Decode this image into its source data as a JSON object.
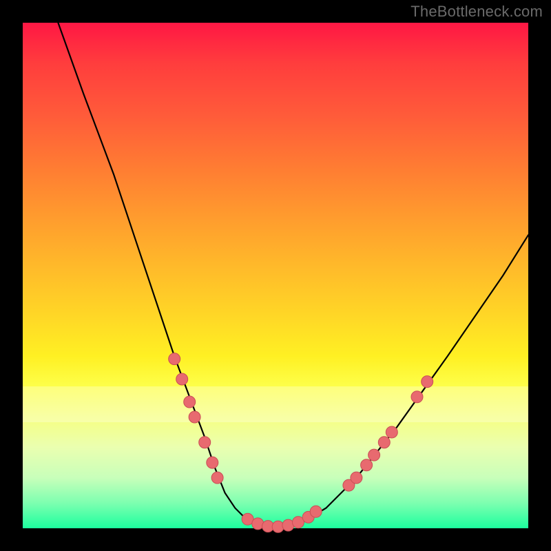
{
  "watermark": "TheBottleneck.com",
  "colors": {
    "frame": "#000000",
    "dot_fill": "#e86a6f",
    "dot_stroke": "#c94e55",
    "curve": "#000000"
  },
  "chart_data": {
    "type": "line",
    "title": "",
    "xlabel": "",
    "ylabel": "",
    "xlim": [
      0,
      100
    ],
    "ylim": [
      0,
      100
    ],
    "grid": false,
    "legend": "none",
    "series": [
      {
        "name": "bottleneck-curve",
        "x": [
          7,
          12,
          18,
          23,
          27,
          30,
          33,
          36,
          38,
          40,
          42,
          44,
          47,
          51,
          55,
          60,
          66,
          74,
          84,
          95,
          100
        ],
        "y": [
          100,
          86,
          70,
          55,
          43,
          34,
          26,
          18,
          12,
          7,
          4,
          2,
          0,
          0,
          1,
          4,
          10,
          20,
          34,
          50,
          58
        ]
      }
    ],
    "scatter": {
      "name": "highlight-dots",
      "points": [
        {
          "x": 30.0,
          "y": 33.5
        },
        {
          "x": 31.5,
          "y": 29.5
        },
        {
          "x": 33.0,
          "y": 25.0
        },
        {
          "x": 34.0,
          "y": 22.0
        },
        {
          "x": 36.0,
          "y": 17.0
        },
        {
          "x": 37.5,
          "y": 13.0
        },
        {
          "x": 38.5,
          "y": 10.0
        },
        {
          "x": 44.5,
          "y": 1.8
        },
        {
          "x": 46.5,
          "y": 0.9
        },
        {
          "x": 48.5,
          "y": 0.4
        },
        {
          "x": 50.5,
          "y": 0.3
        },
        {
          "x": 52.5,
          "y": 0.6
        },
        {
          "x": 54.5,
          "y": 1.2
        },
        {
          "x": 56.5,
          "y": 2.2
        },
        {
          "x": 58.0,
          "y": 3.3
        },
        {
          "x": 64.5,
          "y": 8.5
        },
        {
          "x": 66.0,
          "y": 10.0
        },
        {
          "x": 68.0,
          "y": 12.5
        },
        {
          "x": 69.5,
          "y": 14.5
        },
        {
          "x": 71.5,
          "y": 17.0
        },
        {
          "x": 73.0,
          "y": 19.0
        },
        {
          "x": 78.0,
          "y": 26.0
        },
        {
          "x": 80.0,
          "y": 29.0
        }
      ]
    },
    "band": {
      "y0": 21,
      "y1": 28
    }
  }
}
